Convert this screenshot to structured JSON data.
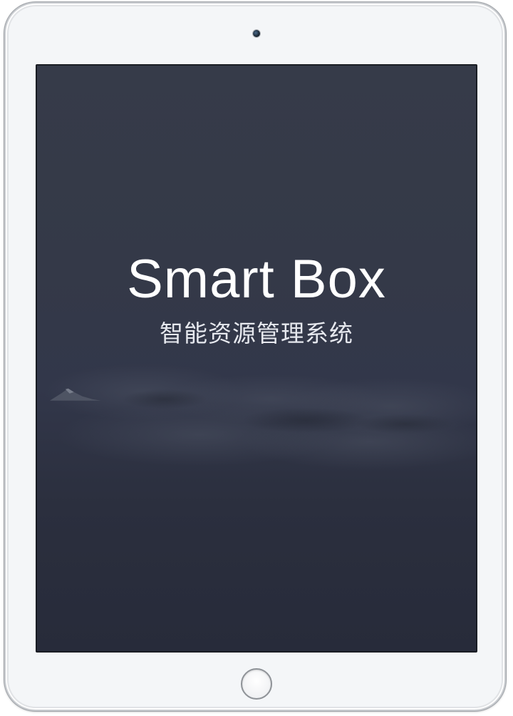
{
  "screen": {
    "title": "Smart Box",
    "subtitle": "智能资源管理系统"
  },
  "colors": {
    "bezel": "#f4f6f8",
    "screen_background": "#343948",
    "title_text": "#ffffff"
  },
  "icons": {
    "camera": "front-camera-icon",
    "home": "home-button-icon"
  }
}
